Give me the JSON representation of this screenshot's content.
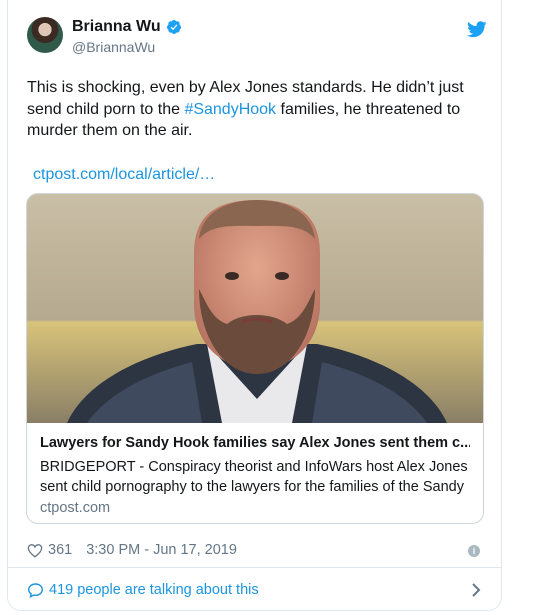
{
  "author": {
    "name": "Brianna Wu",
    "handle": "@BriannaWu"
  },
  "tweet": {
    "text_before": "This is shocking, even by Alex Jones standards. He didn’t just send child porn to the ",
    "hashtag": "#SandyHook",
    "text_after": " families, he threatened to murder them on the air.",
    "link": "ctpost.com/local/article/…"
  },
  "preview": {
    "title": "Lawyers for Sandy Hook families say Alex Jones sent them c...",
    "description": "BRIDGEPORT - Conspiracy theorist and InfoWars host Alex Jones sent child pornography to the lawyers for the families of the Sandy",
    "domain": "ctpost.com"
  },
  "meta": {
    "likes": "361",
    "timestamp": "3:30 PM - Jun 17, 2019"
  },
  "conversation": {
    "label": "419 people are talking about this"
  },
  "colors": {
    "link": "#1b95e0",
    "muted": "#657786",
    "text": "#14171a"
  },
  "icons": [
    "verified-badge-icon",
    "twitter-bird-icon",
    "heart-icon",
    "info-icon",
    "speech-bubble-icon",
    "chevron-right-icon"
  ]
}
